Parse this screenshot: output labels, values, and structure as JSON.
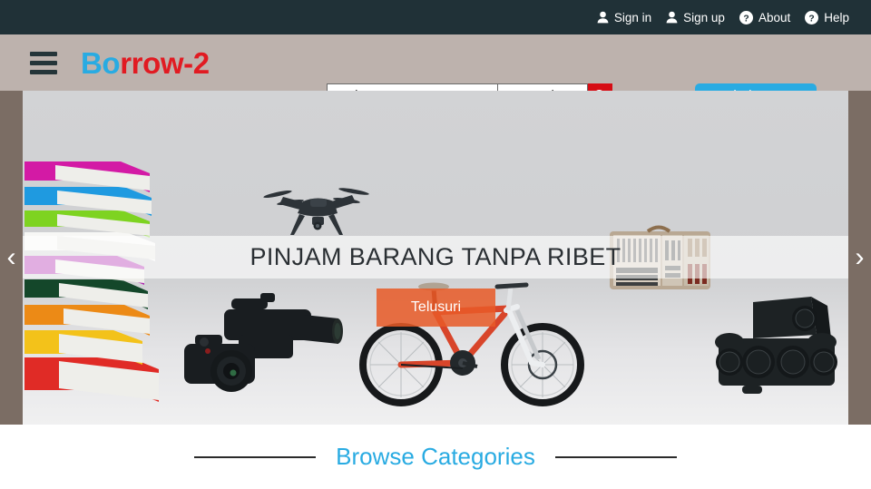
{
  "topbar": {
    "links": [
      {
        "label": "Sign in",
        "icon": "user-icon"
      },
      {
        "label": "Sign up",
        "icon": "user-icon"
      },
      {
        "label": "About",
        "icon": "question-circle-icon"
      },
      {
        "label": "Help",
        "icon": "question-circle-icon"
      }
    ],
    "background_color": "#203137"
  },
  "header": {
    "menu_icon": "hamburger-icon",
    "brand": {
      "part1": "Bo",
      "part2": "rrow-2",
      "color1": "#29abe2",
      "color2": "#e11b22"
    },
    "background_color": "#bdb2ad",
    "search": {
      "placeholder": "Cari....",
      "value": "",
      "category_label": "Kategori",
      "category_options": [
        "Kategori"
      ],
      "button_icon": "search-icon",
      "button_color": "#d60d14"
    },
    "add_button": {
      "label": "Tambah Barang",
      "color": "#29abe2"
    }
  },
  "carousel": {
    "title": "PINJAM BARANG TANPA RIBET",
    "cta_label": "Telusuri",
    "cta_color": "#e85b28",
    "prev_icon": "chevron-left-icon",
    "next_icon": "chevron-right-icon",
    "prev_label": "‹",
    "next_label": "›",
    "items": [
      "books",
      "drone",
      "camera",
      "bicycle",
      "toolcase",
      "speakers"
    ],
    "frame_color": "#7b6d64"
  },
  "browse": {
    "title": "Browse Categories",
    "title_color": "#29abe2"
  }
}
